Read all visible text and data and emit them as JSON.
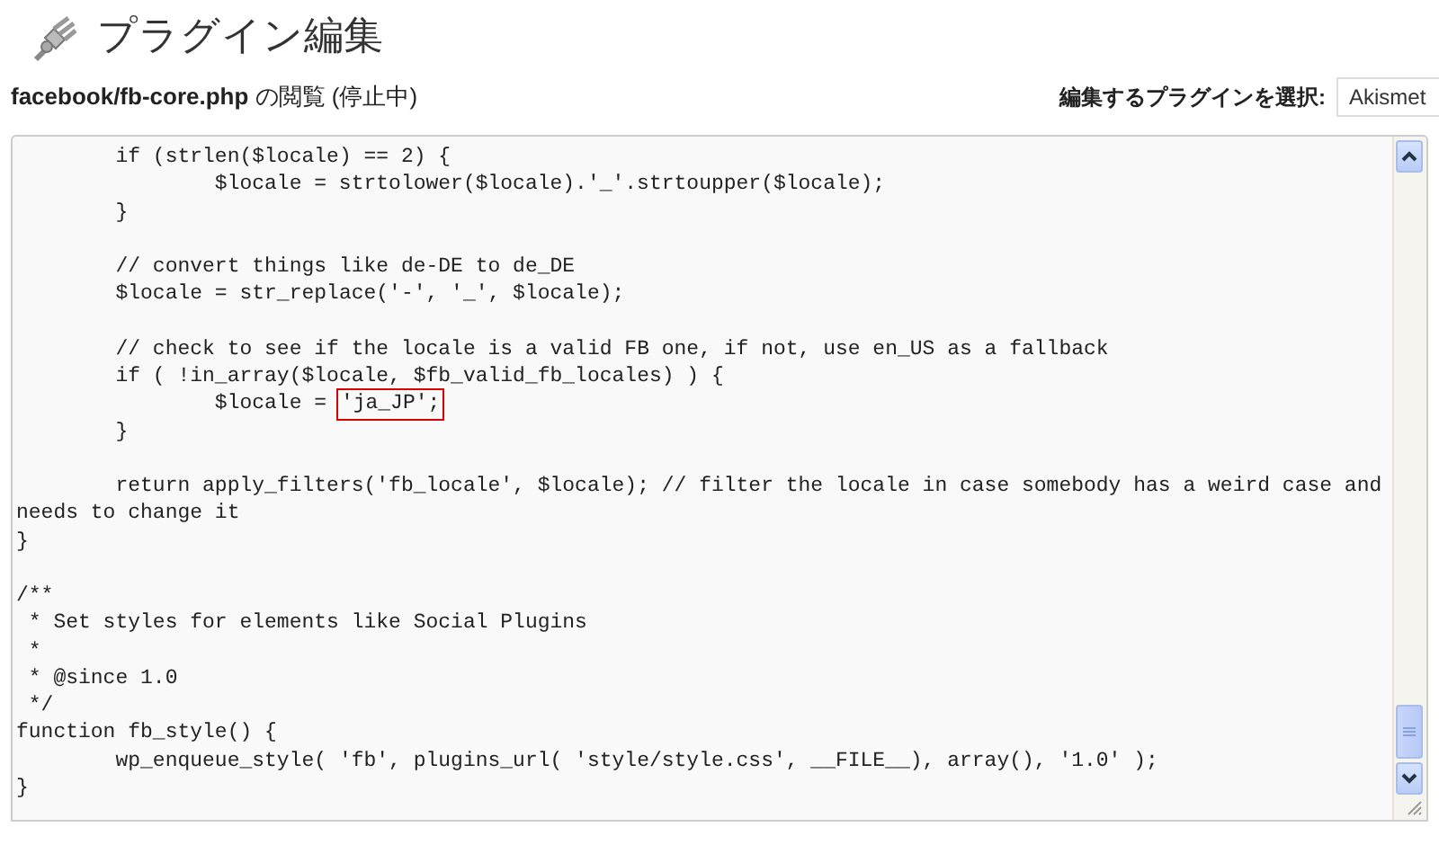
{
  "page_title": "プラグイン編集",
  "file_heading": {
    "file": "facebook/fb-core.php",
    "suffix": "の閲覧 (停止中)"
  },
  "plugin_select": {
    "label": "編集するプラグインを選択:",
    "value": "Akismet"
  },
  "editor": {
    "lines": [
      {
        "kind": "code",
        "text": "\tif (strlen($locale) == 2) {"
      },
      {
        "kind": "code",
        "text": "\t\t$locale = strtolower($locale).'_'.strtoupper($locale);"
      },
      {
        "kind": "code",
        "text": "\t}"
      },
      {
        "kind": "blank"
      },
      {
        "kind": "code",
        "text": "\t// convert things like de-DE to de_DE"
      },
      {
        "kind": "code",
        "text": "\t$locale = str_replace('-', '_', $locale);"
      },
      {
        "kind": "blank"
      },
      {
        "kind": "code",
        "text": "\t// check to see if the locale is a valid FB one, if not, use en_US as a fallback"
      },
      {
        "kind": "code",
        "text": "\tif ( !in_array($locale, $fb_valid_fb_locales) ) {"
      },
      {
        "kind": "boxed",
        "text": "\t\t$locale = ",
        "boxed": "'ja_JP';"
      },
      {
        "kind": "code",
        "text": "\t}"
      },
      {
        "kind": "blank"
      },
      {
        "kind": "code",
        "text": "\treturn apply_filters('fb_locale', $locale); // filter the locale in case somebody has a weird case and"
      },
      {
        "kind": "code",
        "text": "needs to change it"
      },
      {
        "kind": "code",
        "text": "}"
      },
      {
        "kind": "blank"
      },
      {
        "kind": "code",
        "text": "/**"
      },
      {
        "kind": "code",
        "text": " * Set styles for elements like Social Plugins"
      },
      {
        "kind": "code",
        "text": " *"
      },
      {
        "kind": "code",
        "text": " * @since 1.0"
      },
      {
        "kind": "code",
        "text": " */"
      },
      {
        "kind": "code",
        "text": "function fb_style() {"
      },
      {
        "kind": "code",
        "text": "\twp_enqueue_style( 'fb', plugins_url( 'style/style.css', __FILE__), array(), '1.0' );"
      },
      {
        "kind": "code",
        "text": "}"
      }
    ]
  }
}
